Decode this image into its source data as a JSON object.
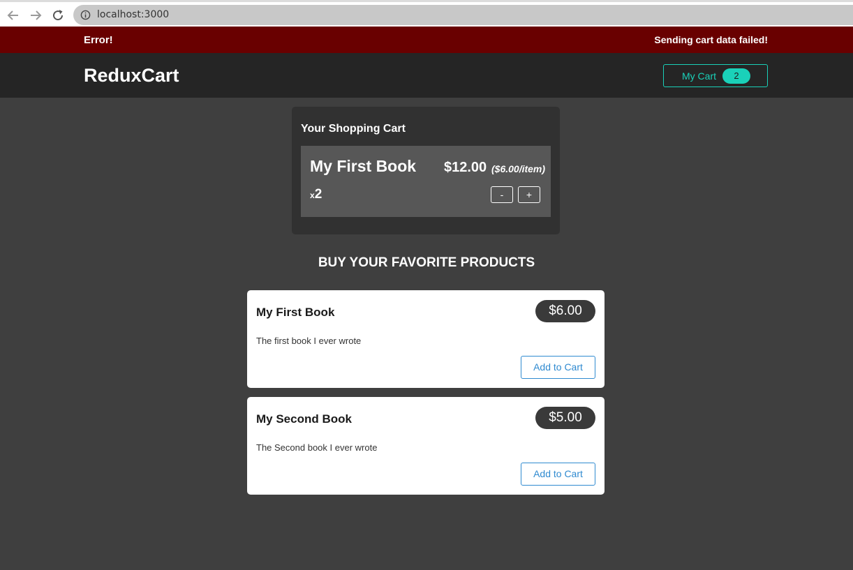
{
  "browser": {
    "url": "localhost:3000",
    "icons": [
      "arrow-left-icon",
      "arrow-right-icon",
      "reload-icon",
      "info-icon"
    ]
  },
  "notification": {
    "title": "Error!",
    "message": "Sending cart data failed!"
  },
  "header": {
    "logo": "ReduxCart",
    "cart_button_label": "My Cart",
    "cart_count": "2"
  },
  "cart": {
    "heading": "Your Shopping Cart",
    "items": [
      {
        "title": "My First Book",
        "total": "$12.00",
        "unit_price": "($6.00/item)",
        "quantity_prefix": "x",
        "quantity": "2",
        "decrease_label": "-",
        "increase_label": "+"
      }
    ]
  },
  "products": {
    "heading": "BUY YOUR FAVORITE PRODUCTS",
    "items": [
      {
        "title": "My First Book",
        "price": "$6.00",
        "description": "The first book I ever wrote",
        "add_label": "Add to Cart"
      },
      {
        "title": "My Second Book",
        "price": "$5.00",
        "description": "The Second book I ever wrote",
        "add_label": "Add to Cart"
      }
    ]
  },
  "colors": {
    "error_bar": "#690000",
    "accent": "#1ad1b9",
    "link_blue": "#2f8ad0",
    "page_bg": "#3f3f3f"
  }
}
